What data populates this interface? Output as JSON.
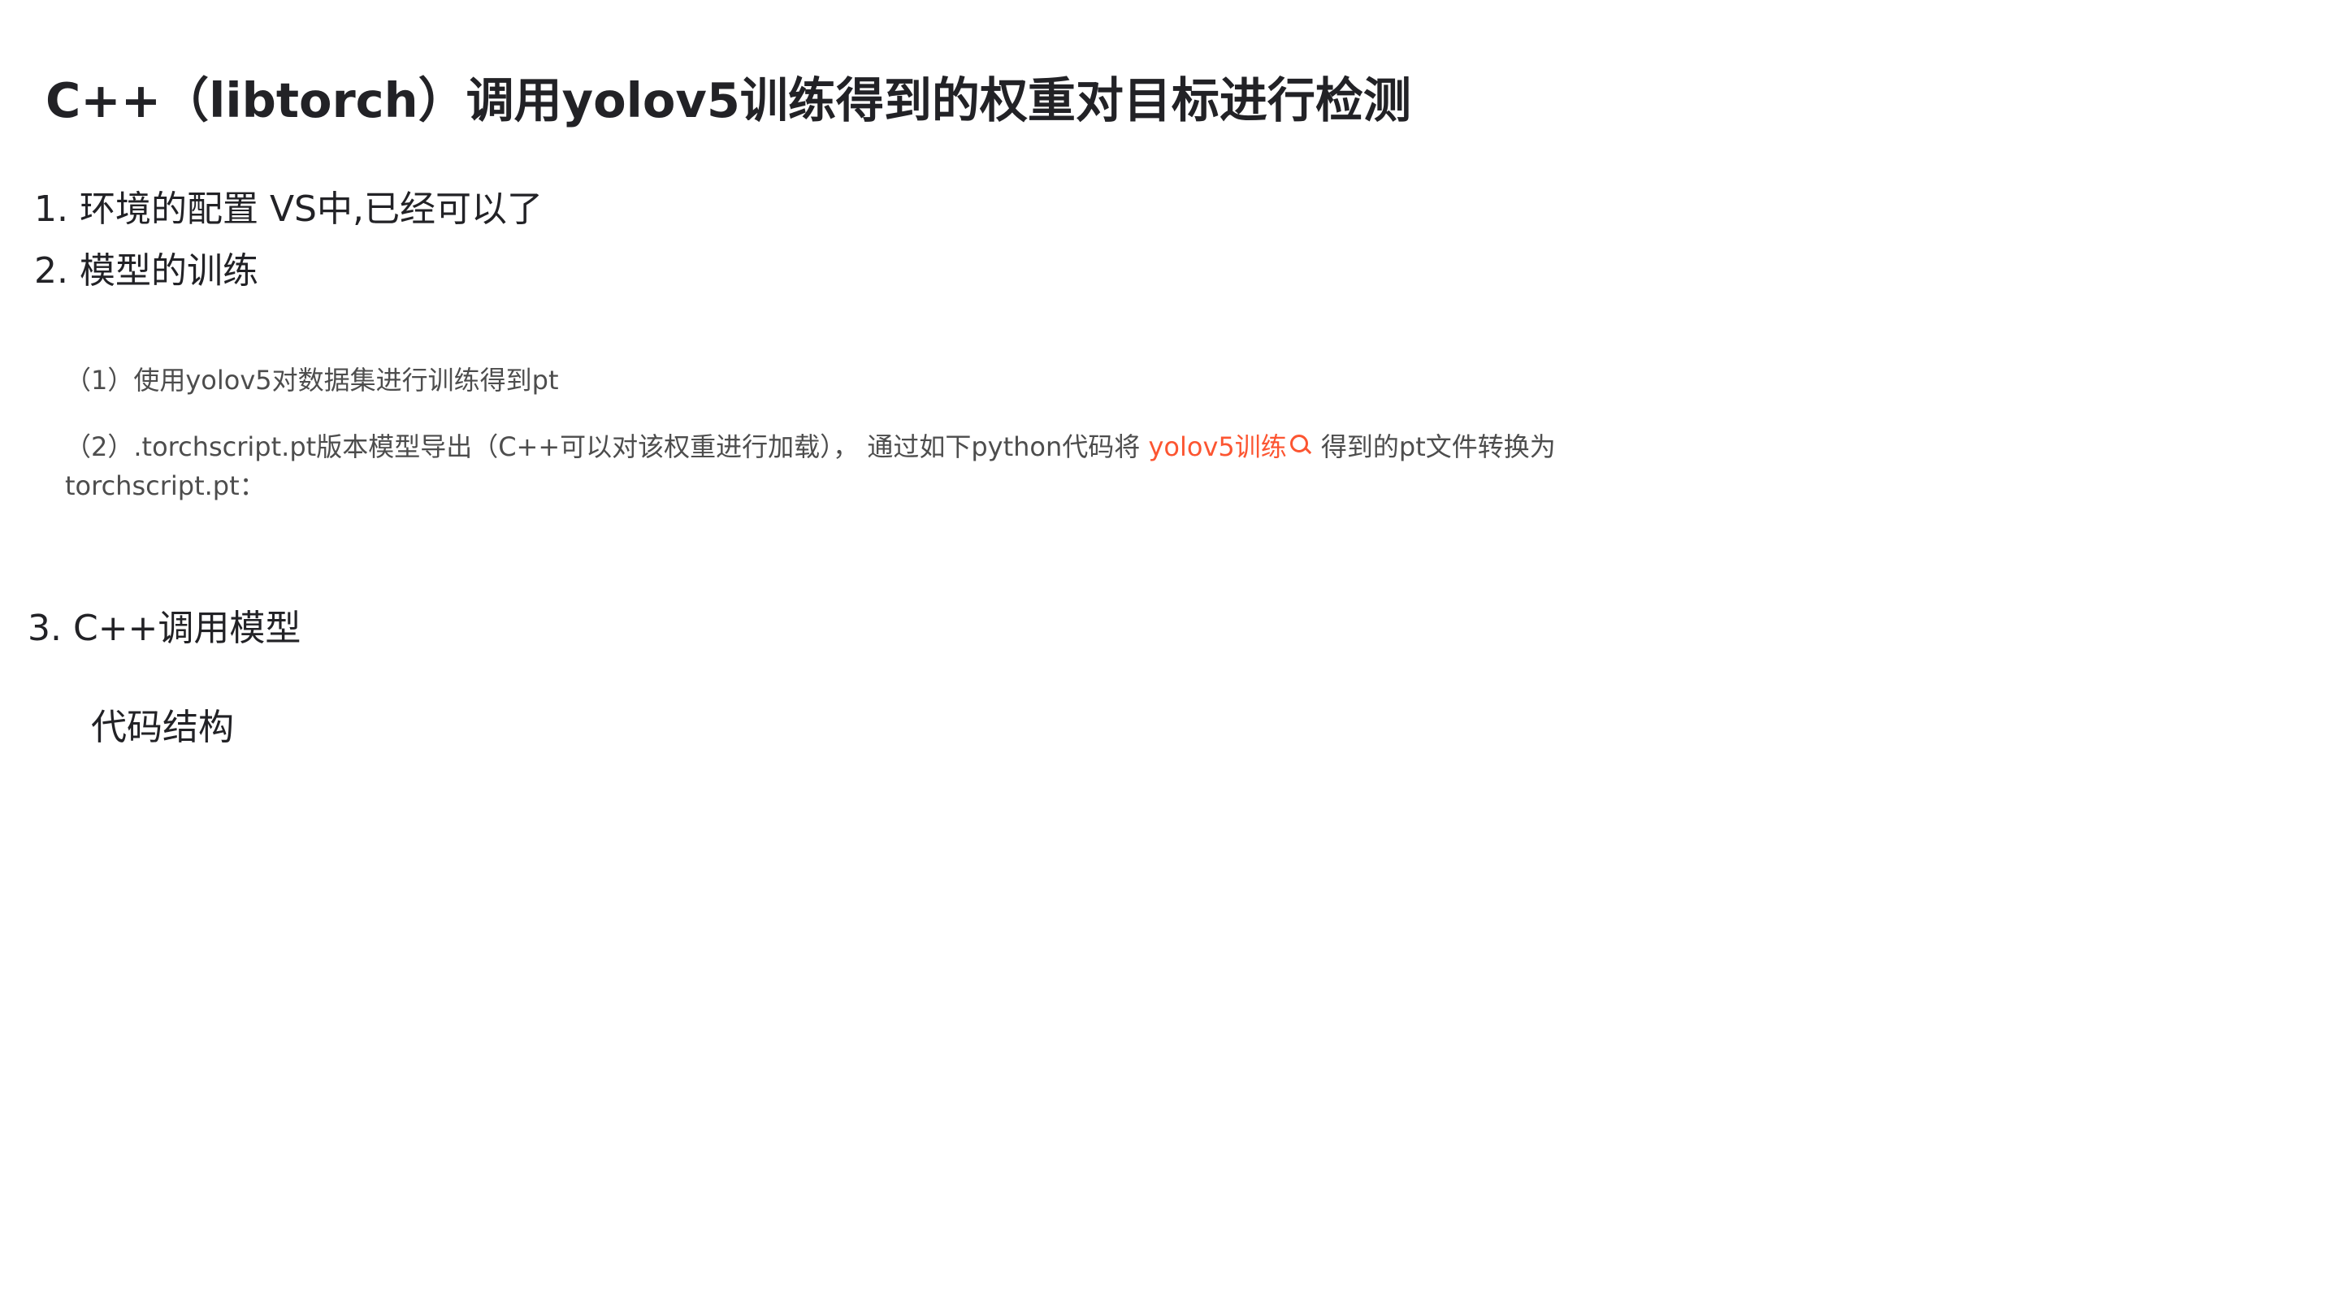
{
  "article": {
    "title": "C++（libtorch）调用yolov5训练得到的权重对目标进行检测",
    "sections": [
      {
        "heading": "1. 环境的配置 VS中,已经可以了"
      },
      {
        "heading": "2. 模型的训练",
        "step1": "（1）使用yolov5对数据集进行训练得到pt",
        "step2_before": "（2）.torchscript.pt版本模型导出（C++可以对该权重进行加载），  通过如下python代码将 ",
        "step2_link": "yolov5训练",
        "step2_after": " 得到的pt文件转换为",
        "step2_line2": "torchscript.pt："
      },
      {
        "heading": "3. C++调用模型",
        "subheading": "代码结构"
      }
    ]
  },
  "colors": {
    "text": "#222226",
    "paragraph": "#4d4d4d",
    "keyword_link": "#fc5531"
  },
  "icons": {
    "keyword_search": "search-icon"
  }
}
